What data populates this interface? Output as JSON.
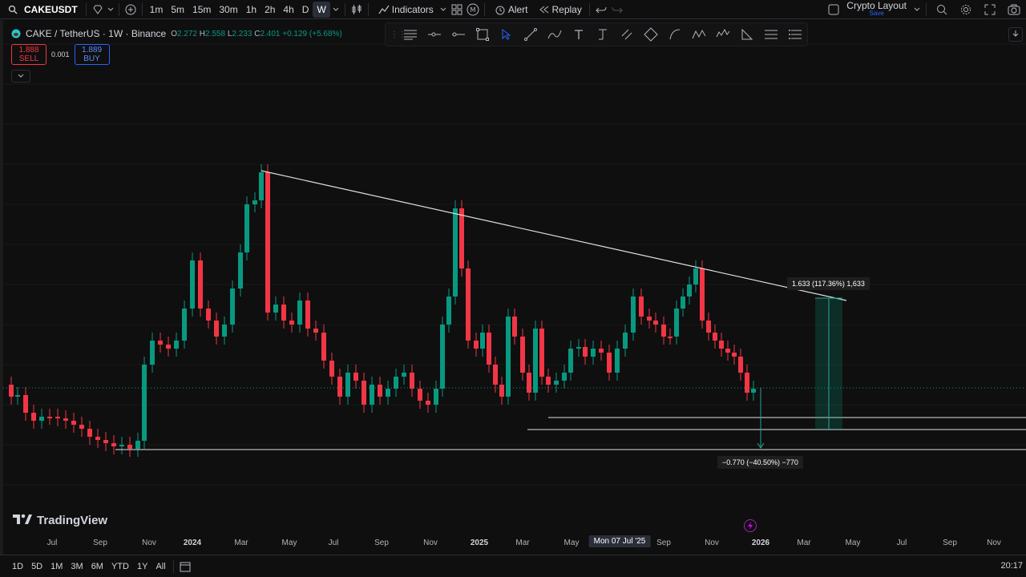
{
  "toolbar": {
    "symbol": "CAKEUSDT",
    "intervals": [
      "1m",
      "5m",
      "15m",
      "30m",
      "1h",
      "2h",
      "4h",
      "D",
      "W"
    ],
    "active_interval": "W",
    "indicators_label": "Indicators",
    "alert_label": "Alert",
    "replay_label": "Replay",
    "layout_name": "Crypto Layout",
    "layout_save": "Save"
  },
  "legend": {
    "title": "CAKE / TetherUS · 1W · Binance",
    "o_label": "O",
    "o": "2.272",
    "h_label": "H",
    "h": "2.558",
    "l_label": "L",
    "l": "2.233",
    "c_label": "C",
    "c": "2.401",
    "change": "+0.129 (+5.68%)"
  },
  "trade": {
    "sell_price": "1.888",
    "sell_label": "SELL",
    "spread": "0.001",
    "buy_price": "1.889",
    "buy_label": "BUY"
  },
  "measure": {
    "up_label": "1.633 (117.36%) 1,633",
    "down_label": "−0.770 (−40.50%) −770"
  },
  "brand": "TradingView",
  "time_axis": {
    "ticks": [
      "Jul",
      "Sep",
      "Nov",
      "2024",
      "Mar",
      "May",
      "Jul",
      "Sep",
      "Nov",
      "2025",
      "Mar",
      "May",
      "Sep",
      "Nov",
      "2026",
      "Mar",
      "May",
      "Jul",
      "Sep",
      "Nov"
    ],
    "crosshair": "Mon 07 Jul '25"
  },
  "ranges": [
    "1D",
    "5D",
    "1M",
    "3M",
    "6M",
    "YTD",
    "1Y",
    "All"
  ],
  "clock": "20:17",
  "colors": {
    "up": "#089981",
    "down": "#f23645",
    "accent": "#2962ff"
  }
}
